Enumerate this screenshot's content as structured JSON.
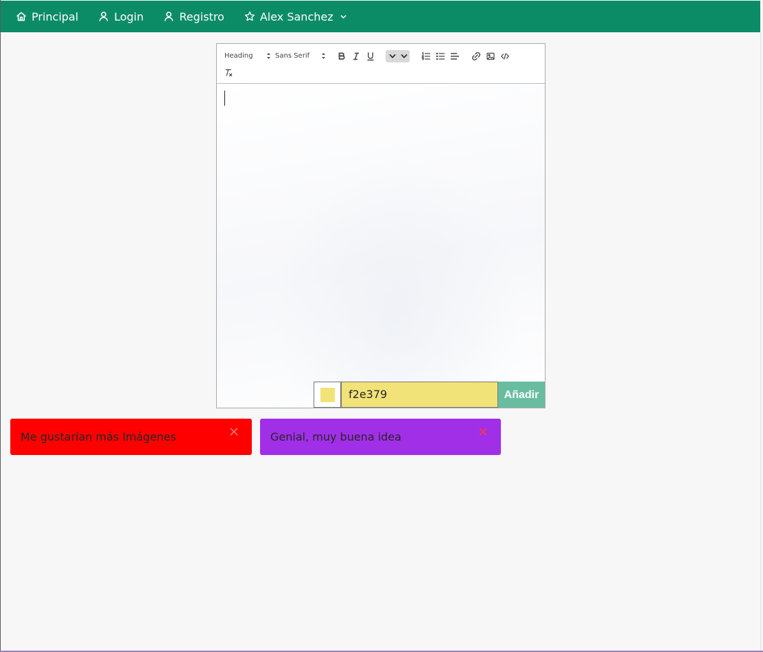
{
  "navbar": {
    "items": [
      {
        "label": "Principal",
        "icon": "home-icon"
      },
      {
        "label": "Login",
        "icon": "user-icon"
      },
      {
        "label": "Registro",
        "icon": "user-icon"
      },
      {
        "label": "Alex Sanchez",
        "icon": "star-icon",
        "dropdown": true
      }
    ]
  },
  "editor": {
    "toolbar": {
      "heading_select": "Heading",
      "font_select": "Sans Serif",
      "size_select": "",
      "buttons": [
        "bold-button",
        "italic-button",
        "underline-button",
        "ordered-list-button",
        "bullet-list-button",
        "align-button",
        "link-button",
        "image-button",
        "code-button",
        "clear-format-button"
      ]
    },
    "content": "",
    "color_value": "f2e379",
    "add_label": "Añadir",
    "colors": {
      "selected": "#f2e379",
      "add_button": "#68bda1",
      "navbar": "#0b8c67"
    }
  },
  "comments": [
    {
      "text": "Me gustarían más Imágenes",
      "color": "#ff0000"
    },
    {
      "text": "Genial, muy buena idea",
      "color": "#a12fe8"
    }
  ]
}
